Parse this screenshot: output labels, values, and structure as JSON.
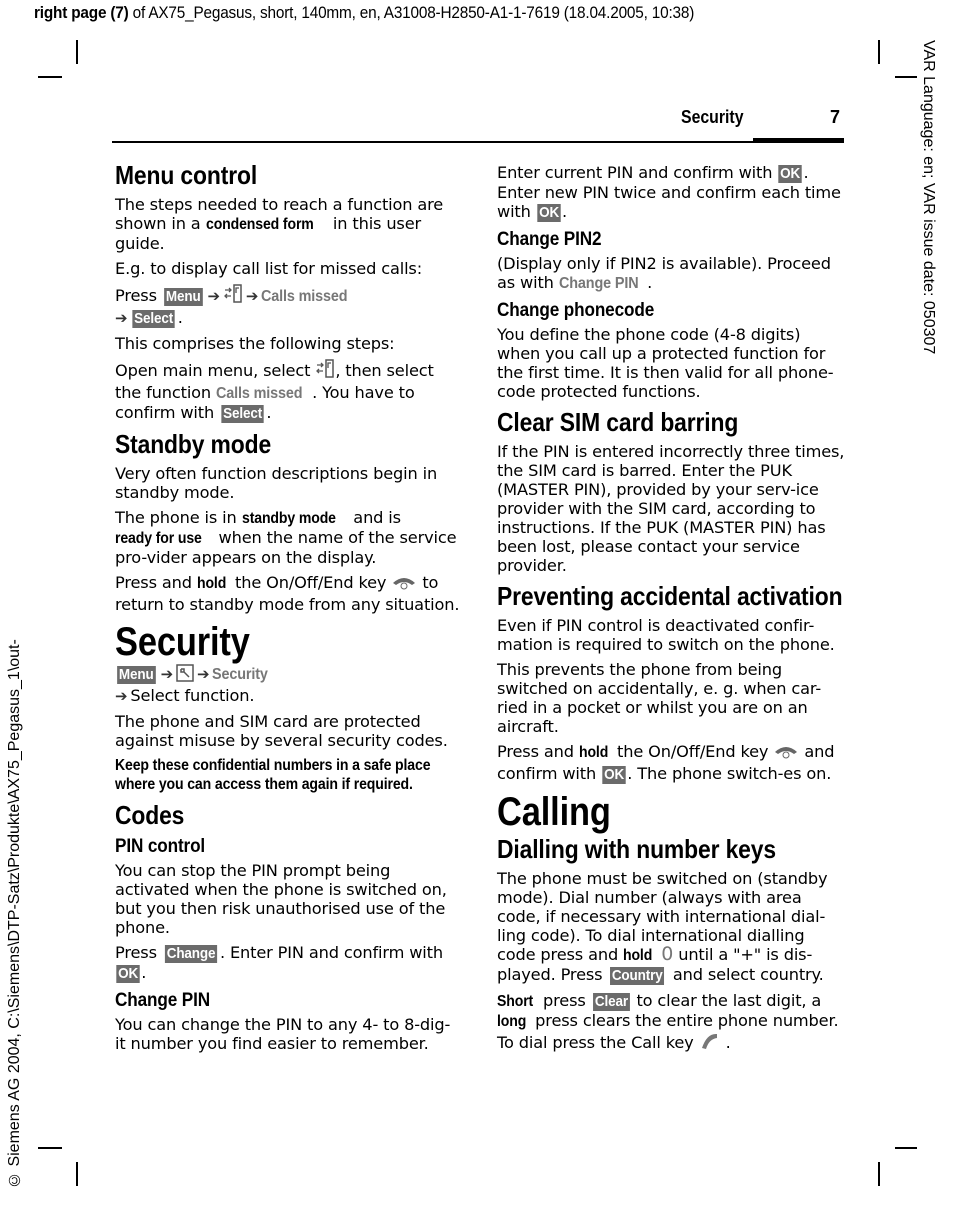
{
  "slug": {
    "bold": "right page (7)",
    "rest": " of AX75_Pegasus, short, 140mm, en, A31008-H2850-A1-1-7619 (18.04.2005, 10:38)"
  },
  "side_right": "VAR Language: en; VAR issue date: 050307",
  "side_left": "© Siemens AG 2004, C:\\Siemens\\DTP-Satz\\Produkte\\AX75_Pegasus_1\\out-",
  "running_header": {
    "title": "Security",
    "page_number": "7"
  },
  "icons": {
    "call_list": "call-list-icon",
    "setup": "setup-wrench-icon",
    "end_key": "end-key-icon",
    "call_key": "call-key-icon",
    "arrow": "➔"
  },
  "softkeys": {
    "menu": "Menu",
    "select": "Select",
    "change": "Change",
    "ok": "OK",
    "country": "Country",
    "clear": "Clear"
  },
  "left": {
    "menu_control": {
      "heading": "Menu control",
      "p1_a": "The steps needed to reach a function are shown in a ",
      "p1_b": "condensed form",
      "p1_c": " in this user guide.",
      "p2": "E.g. to display call list for missed calls:",
      "p3_press": "Press ",
      "p3_menuref": "Calls missed",
      "p4": "This comprises the following steps:",
      "p5_a": "Open main menu, select ",
      "p5_b": ", then select the function ",
      "p5_menuref": "Calls missed",
      "p5_c": ". You have to confirm with ",
      "period": "."
    },
    "standby": {
      "heading": "Standby mode",
      "p1": "Very often function descriptions begin in standby mode.",
      "p2_a": "The phone is in ",
      "p2_b": "standby mode",
      "p2_c": " and is ",
      "p2_d": "ready for use",
      "p2_e": " when the name of the service pro-vider appears on the display.",
      "p3_a": "Press and ",
      "p3_b": "hold",
      "p3_c": " the On/Off/End key ",
      "p3_d": " to return to standby mode from any situation."
    },
    "security": {
      "heading": "Security",
      "path_menuref": "Security",
      "path_line2": "Select function.",
      "p1": "The phone and SIM card are protected against misuse by several security codes.",
      "warning": "Keep these confidential numbers in a safe place where you can access them again if required."
    },
    "codes": {
      "heading": "Codes",
      "pin_control": {
        "heading": "PIN control",
        "p1": "You can stop the PIN prompt being activated when the phone is switched on, but you then risk unauthorised use of the phone.",
        "p2_a": "Press ",
        "p2_b": ". Enter PIN and confirm with ",
        "p2_c": "."
      },
      "change_pin": {
        "heading": "Change PIN",
        "p1": "You can change the PIN to any 4- to 8-dig-it number you find easier to remember."
      }
    }
  },
  "right": {
    "change_pin_cont": {
      "p1_a": "Enter current PIN and confirm with ",
      "p1_b": ". Enter new PIN twice and confirm each time with ",
      "p1_c": "."
    },
    "change_pin2": {
      "heading": "Change PIN2",
      "p1_a": "(Display only if PIN2 is available). Proceed as with ",
      "p1_menuref": "Change PIN",
      "p1_b": "."
    },
    "change_phonecode": {
      "heading": "Change phonecode",
      "p1": "You define the phone code (4-8 digits) when you call up a protected function for the first time. It is then valid for all phone-code protected functions."
    },
    "clear_sim": {
      "heading": "Clear SIM card barring",
      "p1": "If the PIN is entered incorrectly three times, the SIM card is barred. Enter the PUK (MASTER PIN), provided by your serv-ice provider with the SIM card, according to instructions. If the PUK (MASTER PIN) has been lost, please contact your service provider."
    },
    "preventing": {
      "heading": "Preventing accidental activation",
      "p1": "Even if PIN control is deactivated confir-mation is required to switch on the phone.",
      "p2": "This prevents the phone from being switched on accidentally, e. g. when car-ried in a pocket or whilst you are on an aircraft.",
      "p3_a": "Press and ",
      "p3_b": "hold",
      "p3_c": " the On/Off/End key ",
      "p3_d": " and confirm with ",
      "p3_e": ". The phone switch-es on."
    },
    "calling": {
      "heading": "Calling",
      "dialling": {
        "heading": "Dialling with number keys",
        "p1_a": "The phone must be switched on (standby mode). Dial number (always with area code, if necessary with international dial-ling code). To dial international dialling code press and ",
        "p1_b": "hold",
        "p1_key": "0",
        "p1_c": " until a \"+\" is dis-played. Press ",
        "p1_d": " and select country.",
        "p2_a": "Short",
        "p2_b": " press ",
        "p2_c": " to clear the last digit, a ",
        "p2_d": "long",
        "p2_e": " press clears the entire phone number. To dial press the Call key ",
        "p2_f": " ."
      }
    }
  }
}
